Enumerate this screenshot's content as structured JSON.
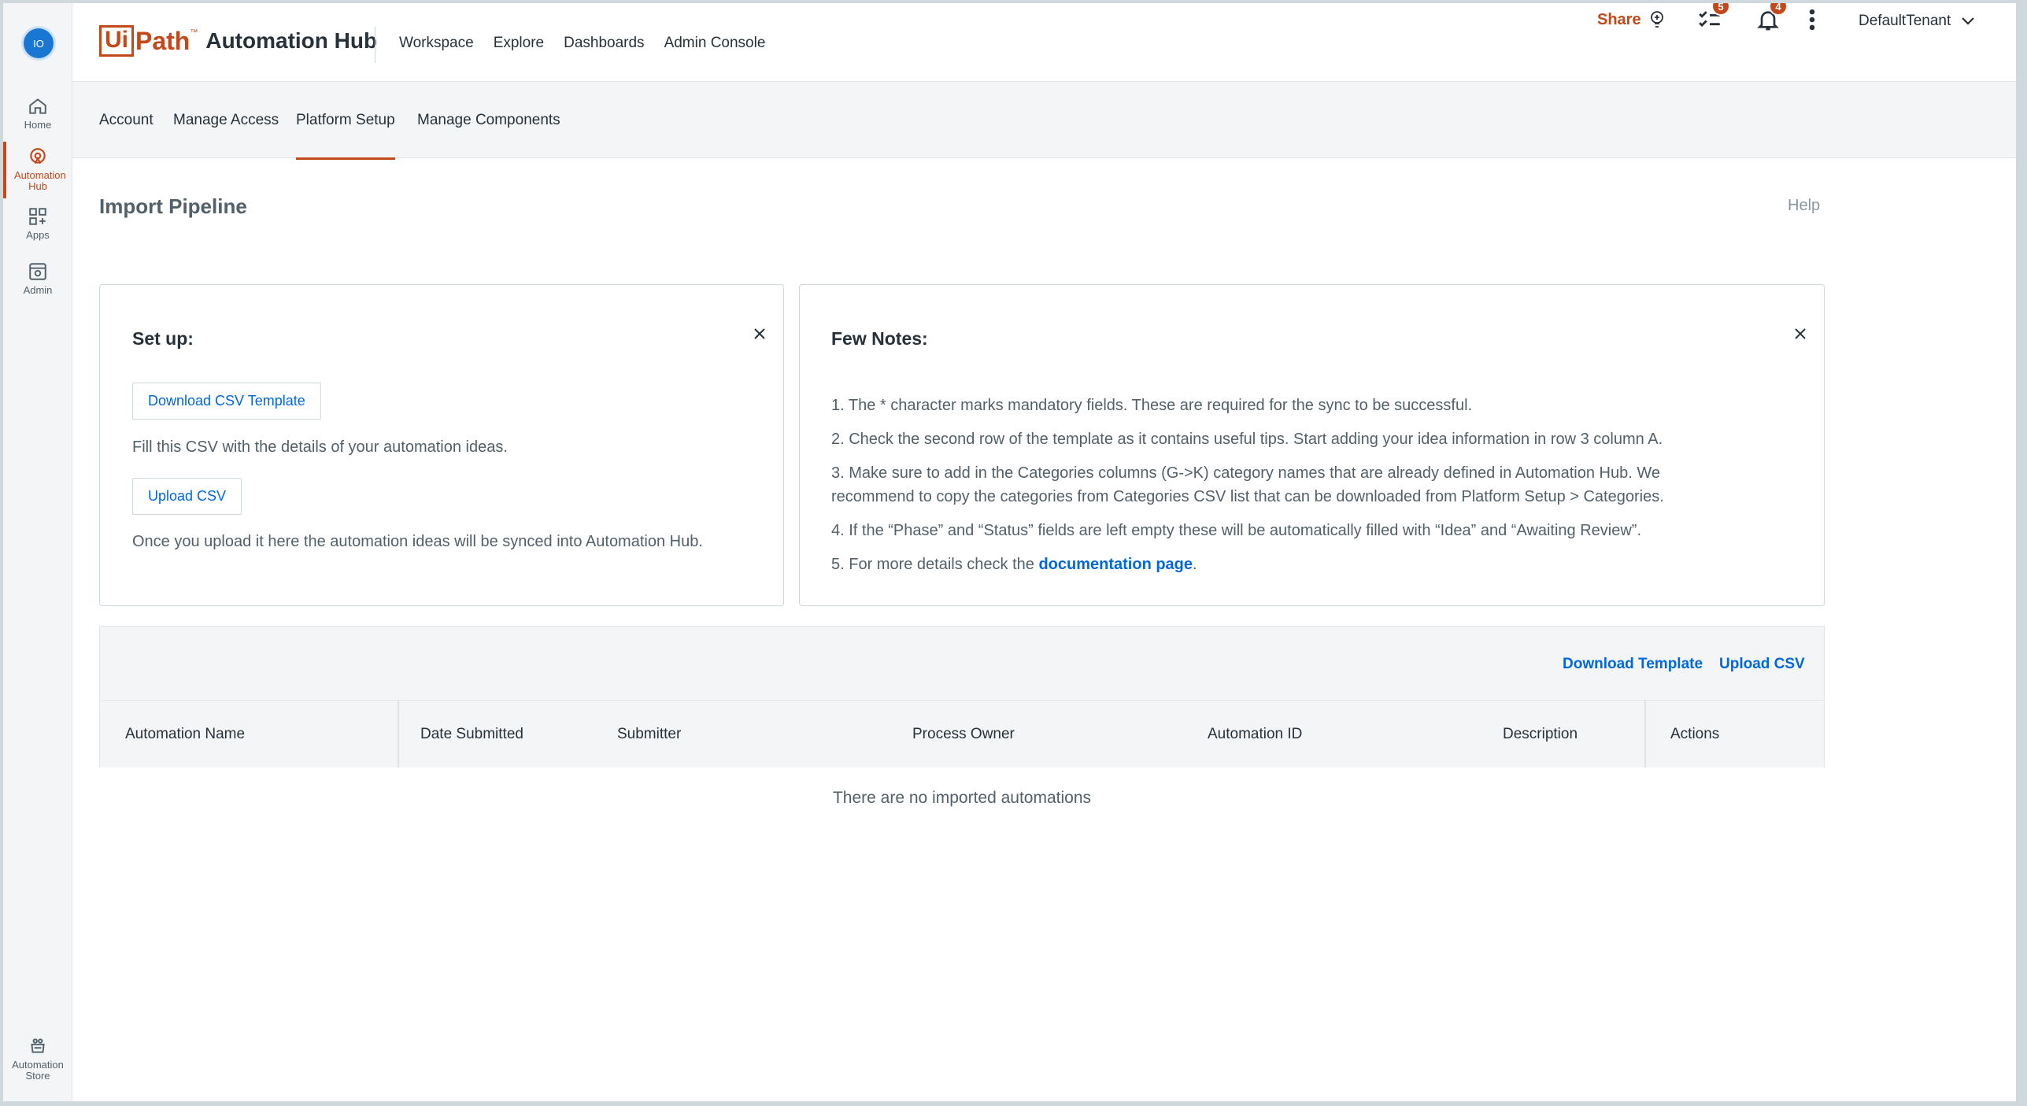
{
  "rail": {
    "avatar": "IO",
    "items": [
      {
        "label": "Home"
      },
      {
        "label": "Automation Hub"
      },
      {
        "label": "Apps"
      },
      {
        "label": "Admin"
      }
    ],
    "bottom_item": {
      "label": "Automation Store"
    }
  },
  "header": {
    "brand_ui": "Ui",
    "brand_path": "Path",
    "brand_tm": "™",
    "brand_product": "Automation Hub",
    "nav": [
      "Workspace",
      "Explore",
      "Dashboards",
      "Admin Console"
    ],
    "share_label": "Share",
    "tasks_count": "5",
    "notifications_count": "4",
    "tenant": "DefaultTenant"
  },
  "subnav": {
    "tabs": [
      "Account",
      "Manage Access",
      "Platform Setup",
      "Manage Components"
    ],
    "active": "Platform Setup"
  },
  "page": {
    "title": "Import Pipeline",
    "help": "Help"
  },
  "setup_card": {
    "title": "Set up:",
    "download_button": "Download CSV Template",
    "fill_text": "Fill this CSV with the details of your automation ideas.",
    "upload_button": "Upload CSV",
    "sync_text": "Once you upload it here the automation ideas will be synced into Automation Hub."
  },
  "notes_card": {
    "title": "Few Notes:",
    "note1": "1. The * character marks mandatory fields. These are required for the sync to be successful.",
    "note2": "2. Check the second row of the template as it contains useful tips. Start adding your idea information in row 3 column A.",
    "note3": "3. Make sure to add in the Categories columns (G->K) category names that are already defined in Automation Hub. We recommend to copy the categories from Categories CSV list that can be downloaded from Platform Setup > Categories.",
    "note4": "4. If the “Phase” and “Status” fields are left empty these will be automatically filled with “Idea” and “Awaiting Review”.",
    "note5_prefix": "5. For more details check the ",
    "note5_link": "documentation page",
    "note5_suffix": "."
  },
  "table": {
    "download_template": "Download Template",
    "upload_csv": "Upload CSV",
    "columns": [
      "Automation Name",
      "Date Submitted",
      "Submitter",
      "Process Owner",
      "Automation ID",
      "Description",
      "Actions"
    ],
    "empty_message": "There are no imported automations"
  },
  "colors": {
    "brand": "#c3491b",
    "link": "#0067df",
    "panel": "#f4f5f7"
  }
}
